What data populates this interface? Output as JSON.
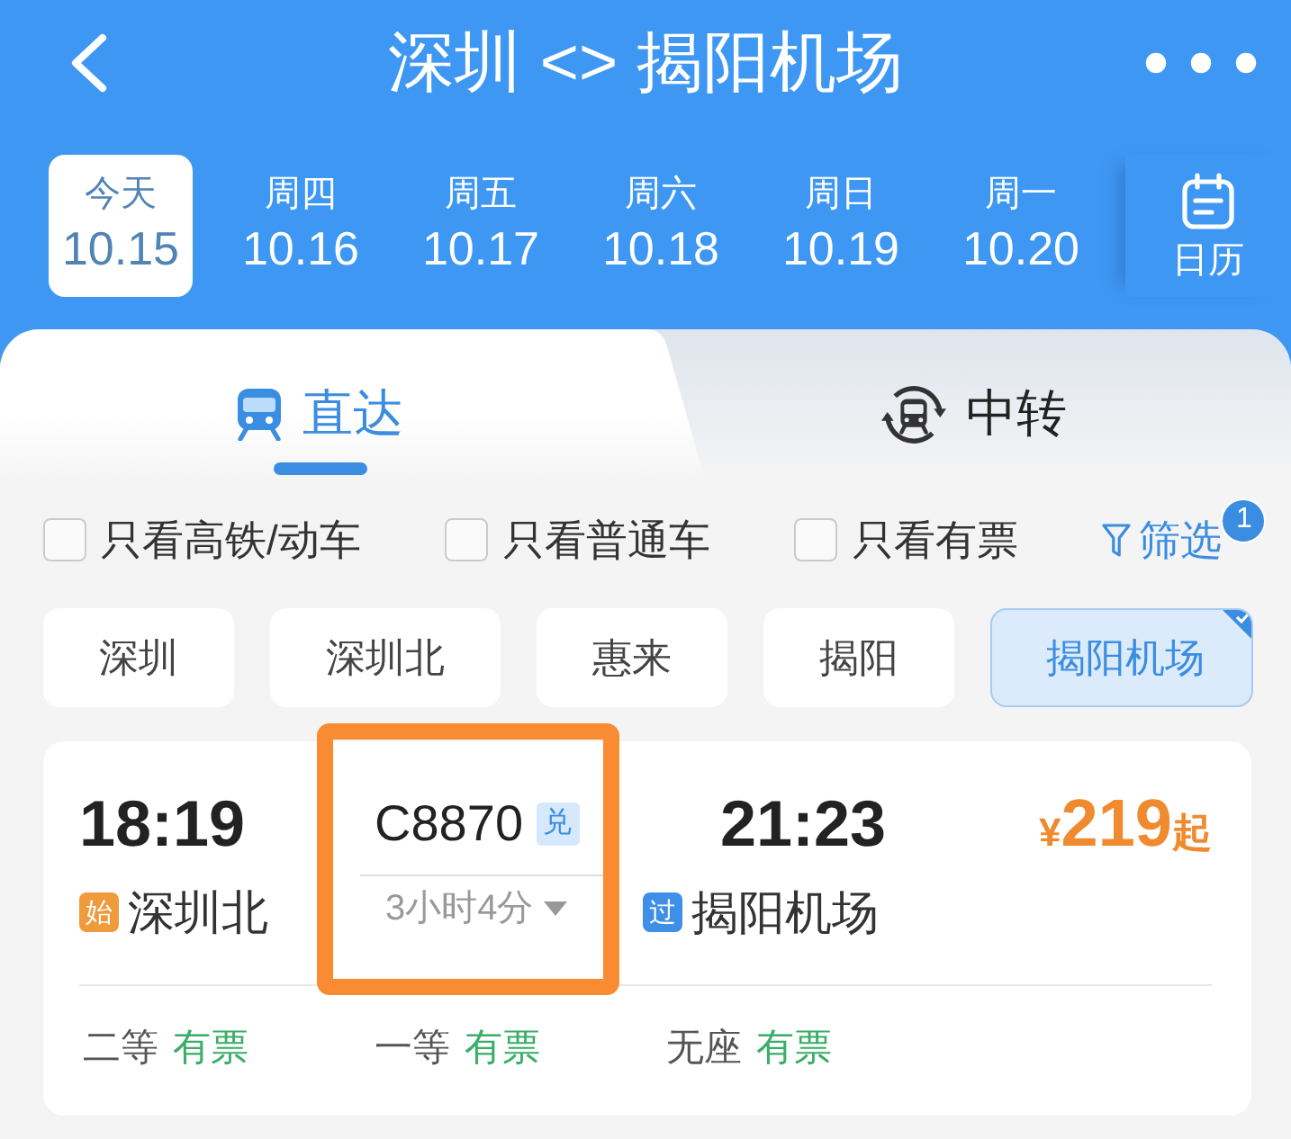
{
  "header": {
    "title": "深圳 <> 揭阳机场"
  },
  "dates": [
    {
      "weekday": "今天",
      "date": "10.15",
      "selected": true
    },
    {
      "weekday": "周四",
      "date": "10.16",
      "selected": false
    },
    {
      "weekday": "周五",
      "date": "10.17",
      "selected": false
    },
    {
      "weekday": "周六",
      "date": "10.18",
      "selected": false
    },
    {
      "weekday": "周日",
      "date": "10.19",
      "selected": false
    },
    {
      "weekday": "周一",
      "date": "10.20",
      "selected": false
    }
  ],
  "calendar": {
    "label": "日历"
  },
  "tabs": [
    {
      "kind": "direct",
      "label": "直达",
      "selected": true
    },
    {
      "kind": "transfer",
      "label": "中转",
      "selected": false
    }
  ],
  "filters": [
    {
      "label": "只看高铁/动车",
      "checked": false
    },
    {
      "label": "只看普通车",
      "checked": false
    },
    {
      "label": "只看有票",
      "checked": false
    }
  ],
  "filter_button": {
    "label": "筛选",
    "badge": "1"
  },
  "stations": [
    {
      "label": "深圳",
      "selected": false
    },
    {
      "label": "深圳北",
      "selected": false
    },
    {
      "label": "惠来",
      "selected": false
    },
    {
      "label": "揭阳",
      "selected": false
    },
    {
      "label": "揭阳机场",
      "selected": true
    }
  ],
  "trains": [
    {
      "depart_time": "18:19",
      "depart_tag": {
        "text": "始",
        "color": "#ef9a3c"
      },
      "depart_station": "深圳北",
      "number": "C8870",
      "number_tag": "兑",
      "duration": "3小时4分",
      "arrive_time": "21:23",
      "arrive_tag": {
        "text": "过",
        "color": "#3e8fe8"
      },
      "arrive_station": "揭阳机场",
      "price": {
        "currency": "¥",
        "amount": "219",
        "suffix": "起"
      },
      "highlighted": true,
      "seats": [
        {
          "class": "二等",
          "status": "有票",
          "available": true
        },
        {
          "class": "一等",
          "status": "有票",
          "available": true
        },
        {
          "class": "无座",
          "status": "有票",
          "available": true
        }
      ]
    }
  ]
}
